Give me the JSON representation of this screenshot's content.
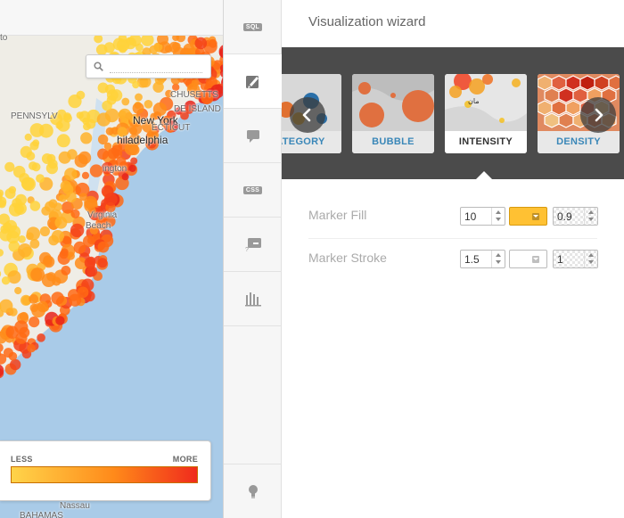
{
  "map": {
    "labels": {
      "new_york": "New York",
      "philadelphia": "hiladelphia",
      "pennsylvania": "PENNSYLV",
      "connecticut": "ECTICUT",
      "massachusetts": "CHUSETTS",
      "rhode_island": "DE ISLAND",
      "virginia_beach_1": "Virginia",
      "virginia_beach_2": "Beach",
      "wilmington": "ington",
      "nassau": "Nassau",
      "bahamas": "BAHAMAS",
      "toronto": "to"
    },
    "search": {
      "placeholder": ""
    },
    "legend": {
      "less": "LESS",
      "more": "MORE",
      "gradient": [
        "#ffd44a",
        "#ff8a1a",
        "#f02b1c"
      ]
    }
  },
  "toolbar": {
    "sql_icon_text": "SQL",
    "css_icon_text": "CSS"
  },
  "wizard": {
    "title": "Visualization wizard",
    "cards": [
      {
        "label": "ATEGORY",
        "selected": false
      },
      {
        "label": "BUBBLE",
        "selected": false
      },
      {
        "label": "INTENSITY",
        "selected": true
      },
      {
        "label": "DENSITY",
        "selected": false
      }
    ],
    "thumb_text": "مان",
    "properties": {
      "marker_fill": {
        "label": "Marker Fill",
        "width": "10",
        "color": "#ffc133",
        "opacity": "0.9"
      },
      "marker_stroke": {
        "label": "Marker Stroke",
        "width": "1.5",
        "color": "#ffffff",
        "opacity": "1"
      }
    }
  },
  "colors": {
    "accent_blue": "#3a87b8",
    "carousel_bg": "#4b4b4b",
    "water": "#a9cbe8"
  }
}
